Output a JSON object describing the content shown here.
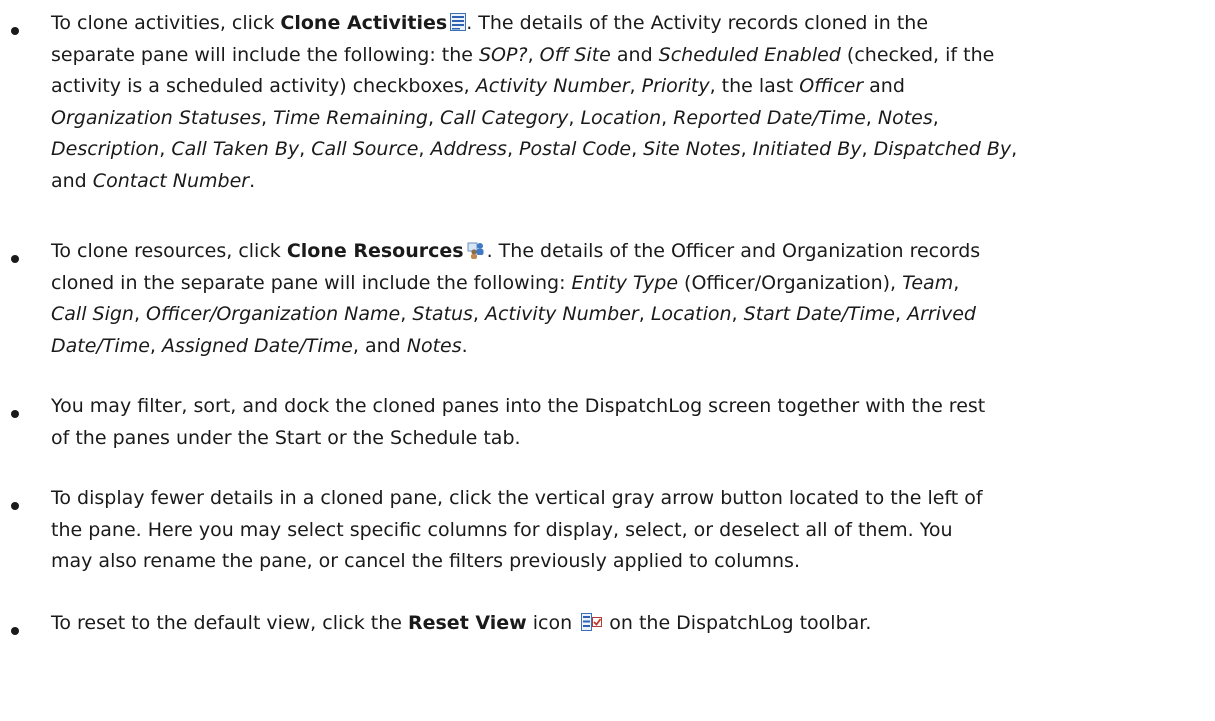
{
  "bullets": [
    {
      "intro": "To clone activities, click ",
      "action": "Clone Activities",
      "icon": "clone-activities-icon",
      "l1_rest": ". The details of the Activity records cloned in the",
      "l2": [
        "separate pane will include the following: the ",
        "SOP?",
        ", ",
        "Off Site",
        " and ",
        "Scheduled Enabled",
        " (checked, if the"
      ],
      "l3": [
        "activity is a scheduled activity) checkboxes, ",
        "Activity Number",
        ", ",
        "Priority",
        ", the last ",
        "Officer",
        " and"
      ],
      "l4": [
        "Organization Statuses",
        ", ",
        "Time Remaining",
        ", ",
        "Call Category",
        ", ",
        "Location",
        ", ",
        "Reported Date/Time",
        ", ",
        "Notes",
        ","
      ],
      "l5": [
        "Description",
        ", ",
        "Call Taken By",
        ", ",
        "Call Source",
        ", ",
        "Address",
        ", ",
        "Postal Code",
        ", ",
        "Site Notes",
        ", ",
        "Initiated By",
        ", ",
        "Dispatched By",
        ","
      ],
      "l6": [
        "and ",
        "Contact Number",
        "."
      ]
    },
    {
      "intro": "To clone resources, click ",
      "action": "Clone Resources",
      "icon": "clone-resources-icon",
      "l1_rest": ". The details of the Officer and Organization records",
      "l2": [
        "cloned in the separate pane will include the following: ",
        "Entity Type",
        " (Officer/Organization), ",
        "Team",
        ","
      ],
      "l3": [
        "Call Sign",
        ", ",
        "Officer/Organization Name",
        ", ",
        "Status",
        ", ",
        "Activity Number",
        ", ",
        "Location",
        ", ",
        "Start Date/Time",
        ", ",
        "Arrived"
      ],
      "l4": [
        "Date/Time",
        ", ",
        "Assigned Date/Time",
        ", and ",
        "Notes",
        "."
      ]
    },
    {
      "l1": "You may filter, sort, and dock the cloned panes into the DispatchLog screen together with the rest",
      "l2": "of the panes under the Start or the Schedule tab."
    },
    {
      "l1": "To display fewer details in a cloned pane, click the vertical gray arrow button located to the left of",
      "l2": "the pane. Here you may select specific columns for display, select, or deselect all of them. You",
      "l3": "may also rename the pane, or cancel the filters previously applied to columns."
    },
    {
      "intro": "To reset to the default view, click the ",
      "action": "Reset View",
      "mid": " icon ",
      "icon": "reset-view-icon",
      "rest": " on the DispatchLog toolbar."
    }
  ]
}
